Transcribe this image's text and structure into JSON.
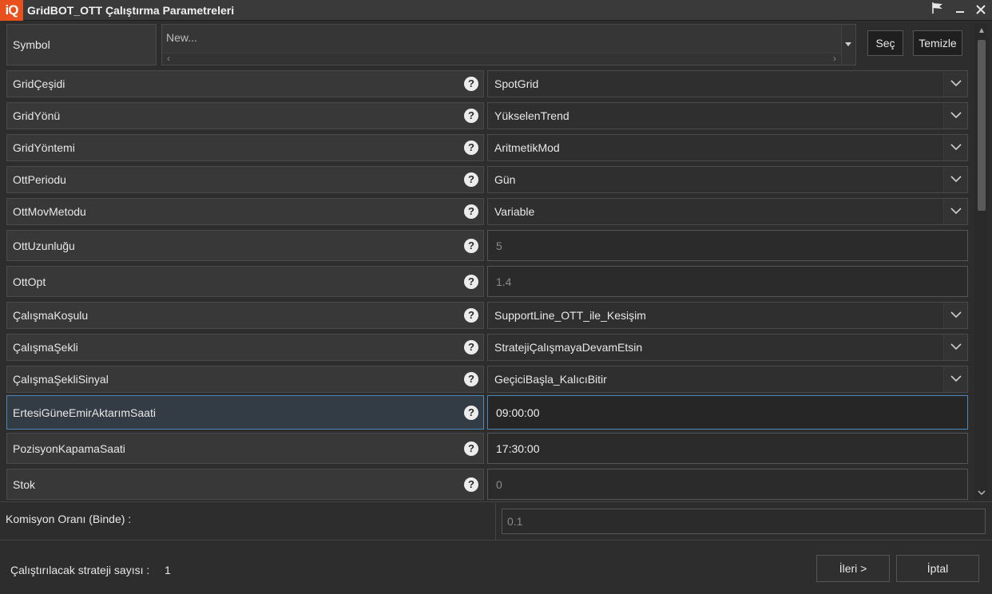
{
  "window": {
    "logo": "iQ",
    "title": "GridBOT_OTT Çalıştırma Parametreleri",
    "flag_icon": "flag-icon",
    "minimize_label": "▬",
    "close_label": "✕"
  },
  "symbol": {
    "label": "Symbol",
    "placeholder": "New...",
    "select_label": "Seç",
    "clear_label": "Temizle"
  },
  "help_glyph": "?",
  "params": [
    {
      "label": "GridÇeşidi",
      "value": "SpotGrid",
      "kind": "combo"
    },
    {
      "label": "GridYönü",
      "value": "YükselenTrend",
      "kind": "combo"
    },
    {
      "label": "GridYöntemi",
      "value": "AritmetikMod",
      "kind": "combo"
    },
    {
      "label": "OttPeriodu",
      "value": "Gün",
      "kind": "combo"
    },
    {
      "label": "OttMovMetodu",
      "value": "Variable",
      "kind": "combo"
    },
    {
      "label": "OttUzunluğu",
      "value": "5",
      "kind": "input"
    },
    {
      "label": "OttOpt",
      "value": "1.4",
      "kind": "input"
    },
    {
      "label": "ÇalışmaKoşulu",
      "value": "SupportLine_OTT_ile_Kesişim",
      "kind": "combo"
    },
    {
      "label": "ÇalışmaŞekli",
      "value": "StratejiÇalışmayaDevamEtsin",
      "kind": "combo"
    },
    {
      "label": "ÇalışmaŞekliSinyal",
      "value": "GeçiciBaşla_KalıcıBitir",
      "kind": "combo"
    },
    {
      "label": "ErtesiGüneEmirAktarımSaati",
      "value": "09:00:00",
      "kind": "input",
      "selected": true
    },
    {
      "label": "PozisyonKapamaSaati",
      "value": "17:30:00",
      "kind": "input"
    },
    {
      "label": "Stok",
      "value": "0",
      "kind": "input"
    }
  ],
  "commission": {
    "label": "Komisyon Oranı (Binde) :",
    "value": "0.1"
  },
  "footer": {
    "count_label": "Çalıştırılacak strateji sayısı :",
    "count_value": "1",
    "next_label": "İleri >",
    "cancel_label": "İptal"
  },
  "colors": {
    "accent": "#e8501e",
    "selection": "#4f86b8",
    "background": "#2d2d2d"
  }
}
